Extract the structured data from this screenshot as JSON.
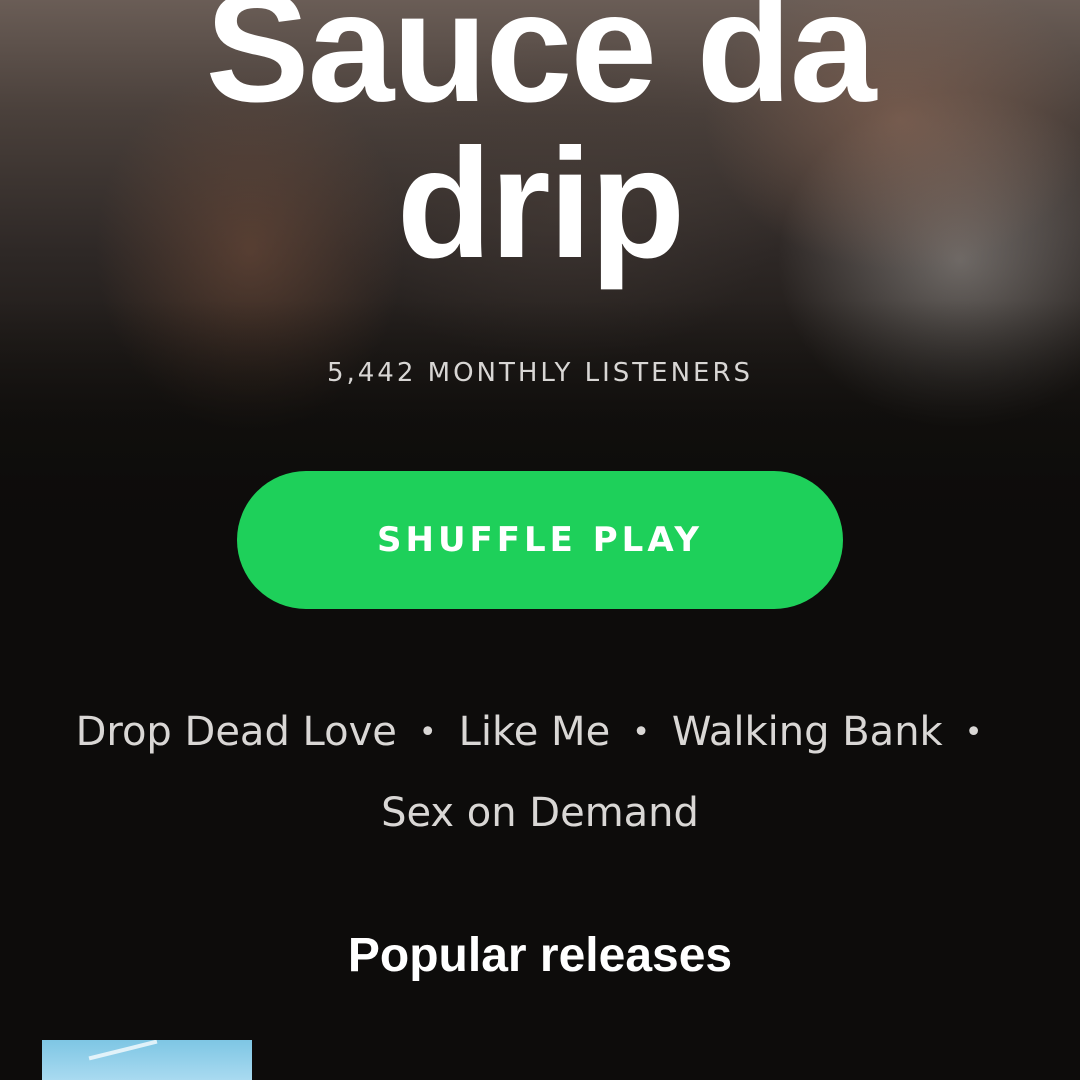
{
  "artist": {
    "name_line1": "Sauce da",
    "name_line2": "drip",
    "monthly_listeners": "5,442 MONTHLY LISTENERS"
  },
  "actions": {
    "shuffle_play_label": "SHUFFLE PLAY",
    "accent_color": "#1ed05a"
  },
  "top_tracks": [
    "Drop Dead Love",
    "Like Me",
    "Walking Bank",
    "Sex on Demand"
  ],
  "separator": "•",
  "sections": {
    "popular_releases_title": "Popular releases"
  }
}
